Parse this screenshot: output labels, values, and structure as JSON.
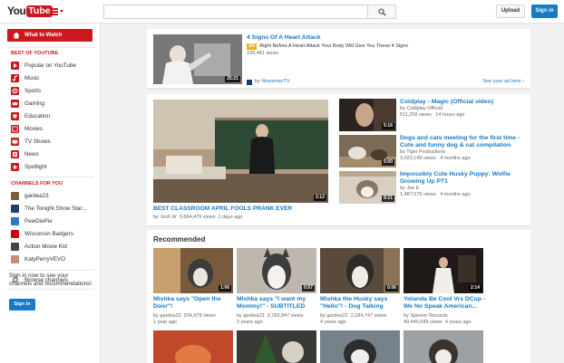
{
  "header": {
    "logo_you": "You",
    "logo_tube": "Tube",
    "search_placeholder": "",
    "upload_label": "Upload",
    "signin_label": "Sign in"
  },
  "guide": {
    "what_to_watch": "What to Watch",
    "best_heading": "BEST OF YOUTUBE",
    "best_items": [
      {
        "label": "Popular on YouTube",
        "icon": "popular-icon",
        "color": "#cc181e"
      },
      {
        "label": "Music",
        "icon": "music-icon",
        "color": "#cc181e"
      },
      {
        "label": "Sports",
        "icon": "sports-icon",
        "color": "#cc181e"
      },
      {
        "label": "Gaming",
        "icon": "gaming-icon",
        "color": "#cc181e"
      },
      {
        "label": "Education",
        "icon": "education-icon",
        "color": "#cc181e"
      },
      {
        "label": "Movies",
        "icon": "movies-icon",
        "color": "#cc181e"
      },
      {
        "label": "TV Shows",
        "icon": "tv-icon",
        "color": "#cc181e"
      },
      {
        "label": "News",
        "icon": "news-icon",
        "color": "#cc181e"
      },
      {
        "label": "Spotlight",
        "icon": "spotlight-icon",
        "color": "#cc181e"
      }
    ],
    "channels_heading": "CHANNELS FOR YOU",
    "channels": [
      {
        "label": "gardea23"
      },
      {
        "label": "The Tonight Show Star..."
      },
      {
        "label": "PewDiePie"
      },
      {
        "label": "Wisconsin Badgers"
      },
      {
        "label": "Action Movie Kid"
      },
      {
        "label": "KatyPerryVEVO"
      }
    ],
    "browse_channels": "Browse channels",
    "signin_prompt": "Sign in now to see your channels and recommendations!",
    "signin_button": "Sign In"
  },
  "ad": {
    "title": "4 Signs Of A Heart Attack",
    "badge": "AD",
    "description": "Right Before A Heart Attack Your Body Will Give You These 4 Signs",
    "views": "239,481 views",
    "duration": "25:21",
    "by_prefix": "by",
    "channel": "NewsmaxTV",
    "see_ad": "See your ad here ›"
  },
  "featured": {
    "title": "BEST CLASSROOM APRIL FOOLS PRANK EVER",
    "by_prefix": "by",
    "channel": "Josh W",
    "views": "9,664,479 views",
    "age": "2 days ago",
    "duration": "2:12"
  },
  "side_videos": [
    {
      "title": "Coldplay - Magic (Official video)",
      "by": "by",
      "channel": "Coldplay Official",
      "views": "511,259 views",
      "age": "14 hours ago",
      "duration": "5:16"
    },
    {
      "title": "Dogs and cats meeting for the first time - Cute and funny dog & cat compilation",
      "by": "by",
      "channel": "Tiger Productions",
      "views": "3,023,149 views",
      "age": "4 months ago",
      "duration": "5:00"
    },
    {
      "title": "Impossibly Cute Husky Puppy: Wolfie Growing Up PT1",
      "by": "by",
      "channel": "Joe E",
      "views": "1,487,570 views",
      "age": "4 months ago",
      "duration": "8:21"
    }
  ],
  "recommended": {
    "heading": "Recommended",
    "items": [
      {
        "title": "Mishka says \"Open the Door\"!",
        "by": "by",
        "channel": "gardea23",
        "views": "934,979 views",
        "age": "1 year ago",
        "duration": "1:06"
      },
      {
        "title": "Mishka says \"I want my Mommy!\" - SUBTITLED",
        "by": "by",
        "channel": "gardea23",
        "views": "3,783,847 views",
        "age": "2 years ago",
        "duration": "0:57"
      },
      {
        "title": "Mishka the Husky says \"Hello\"! - Dog Talking",
        "by": "by",
        "channel": "gardea23",
        "views": "2,184,747 views",
        "age": "4 years ago",
        "duration": "0:06"
      },
      {
        "title": "Yolanda Be Cool Vrs DCup - We No Speak American...",
        "by": "by",
        "channel": "Spinnin' Records",
        "views": "40,440,649 views",
        "age": "4 years ago",
        "duration": "2:14"
      }
    ]
  },
  "colors": {
    "brand": "#cc181e",
    "link": "#167ac6",
    "ad_badge": "#e6b800"
  }
}
